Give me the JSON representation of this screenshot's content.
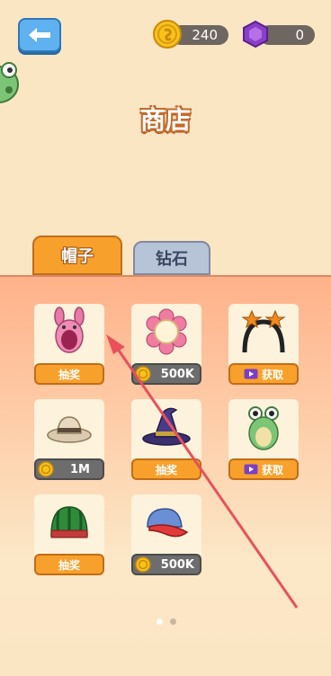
{
  "header": {
    "coins": "240",
    "gems": "0"
  },
  "title": "商店",
  "tabs": [
    {
      "label": "帽子"
    },
    {
      "label": "钻石"
    }
  ],
  "items": [
    {
      "name": "bunny-hood",
      "action": "抽奖"
    },
    {
      "name": "flower-headband",
      "action": "500K"
    },
    {
      "name": "star-headband",
      "action": "获取"
    },
    {
      "name": "fedora",
      "action": "1M"
    },
    {
      "name": "witch-hat",
      "action": "抽奖"
    },
    {
      "name": "frog-hood",
      "action": "获取"
    },
    {
      "name": "watermelon-helmet",
      "action": "抽奖"
    },
    {
      "name": "baseball-cap",
      "action": "500K"
    }
  ],
  "colors": {
    "accent": "#f7a12c",
    "background": "#fbe6c4",
    "panel": "#ffb28a",
    "arrow": "#e8505b"
  }
}
